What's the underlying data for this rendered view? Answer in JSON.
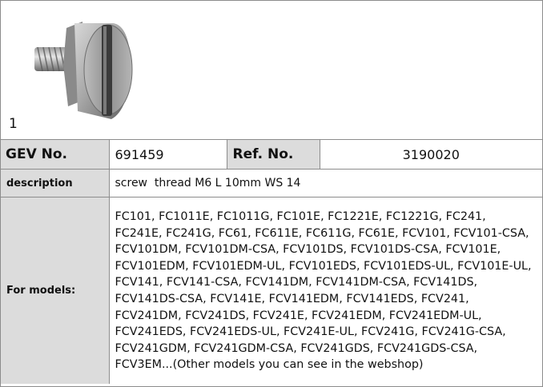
{
  "image": {
    "number": "1",
    "icon": "screw-photo"
  },
  "gev": {
    "label": "GEV No.",
    "value": "691459"
  },
  "ref": {
    "label": "Ref. No.",
    "value": "3190020"
  },
  "description": {
    "label": "description",
    "value": "screw  thread M6 L 10mm WS 14"
  },
  "models": {
    "label": "For models:",
    "value": "FC101, FC1011E, FC1011G, FC101E, FC1221E, FC1221G, FC241, FC241E, FC241G, FC61, FC611E, FC611G, FC61E, FCV101, FCV101-CSA, FCV101DM, FCV101DM-CSA, FCV101DS, FCV101DS-CSA, FCV101E, FCV101EDM, FCV101EDM-UL, FCV101EDS, FCV101EDS-UL, FCV101E-UL, FCV141, FCV141-CSA, FCV141DM, FCV141DM-CSA, FCV141DS, FCV141DS-CSA, FCV141E, FCV141EDM, FCV141EDS, FCV241, FCV241DM, FCV241DS, FCV241E, FCV241EDM, FCV241EDM-UL, FCV241EDS, FCV241EDS-UL, FCV241E-UL, FCV241G, FCV241G-CSA, FCV241GDM, FCV241GDM-CSA, FCV241GDS, FCV241GDS-CSA, FCV3EM...(Other models you can see in the webshop)"
  }
}
